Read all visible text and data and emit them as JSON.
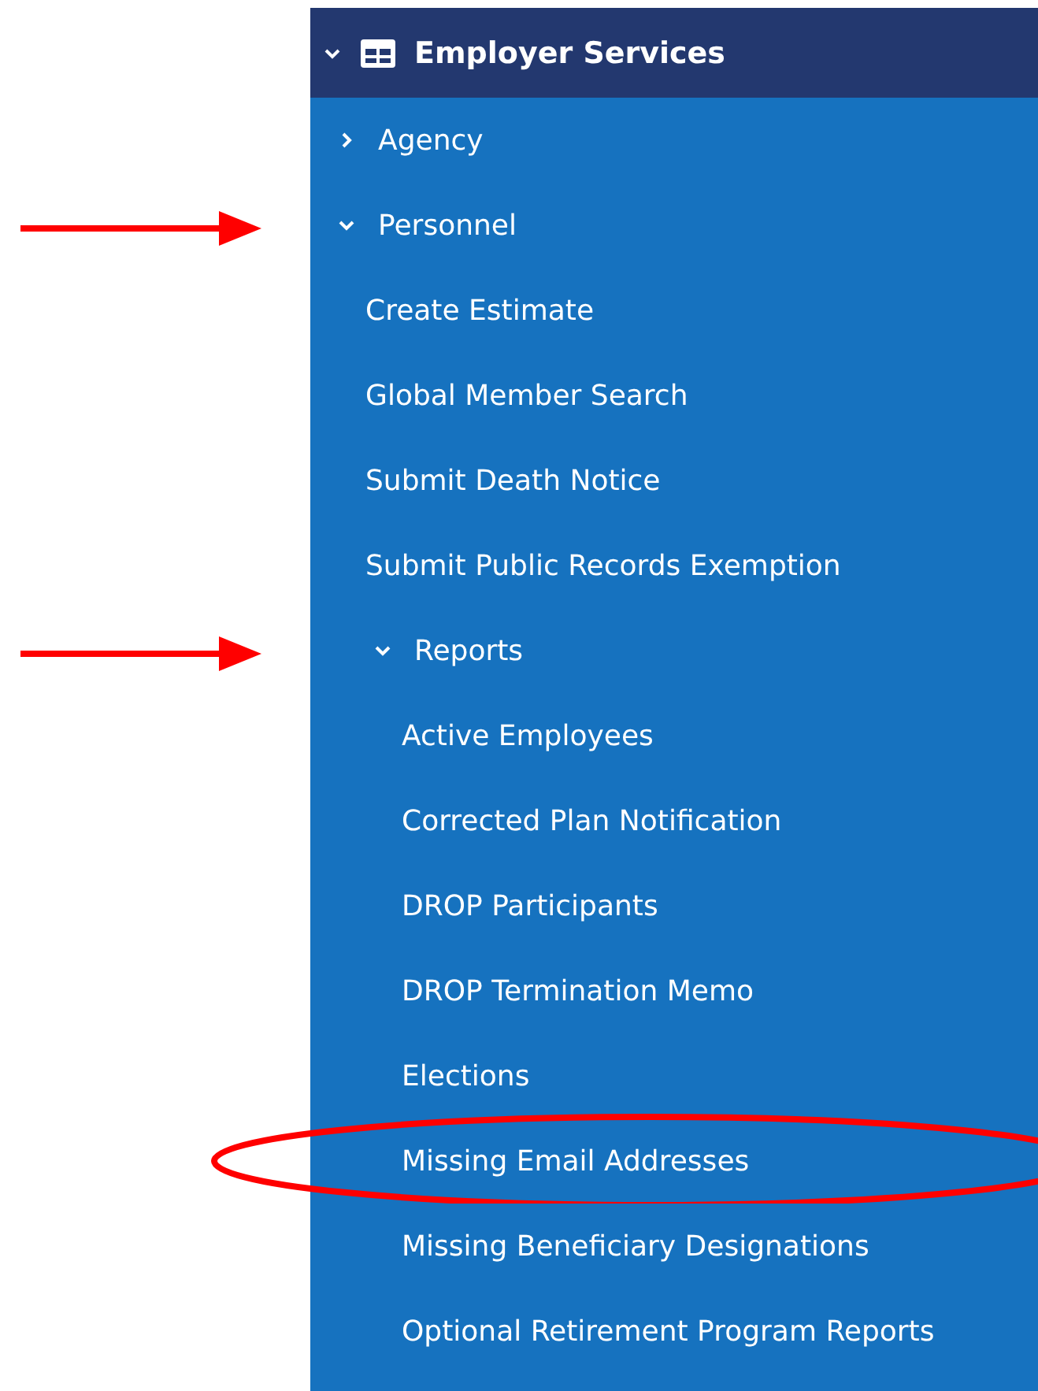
{
  "menu": {
    "label": "Employer Services",
    "expanded": true,
    "children": [
      {
        "label": "Agency",
        "kind": "group",
        "expanded": false,
        "pointed": false
      },
      {
        "label": "Personnel",
        "expanded": true,
        "pointed": true,
        "children": [
          {
            "label": "Create Estimate"
          },
          {
            "label": "Global Member Search"
          },
          {
            "label": "Submit Death Notice"
          },
          {
            "label": "Submit Public Records Exemption"
          },
          {
            "label": "Reports",
            "expanded": true,
            "pointed": true,
            "children": [
              {
                "label": "Active Employees",
                "circled": false
              },
              {
                "label": "Corrected Plan Notification",
                "circled": false
              },
              {
                "label": "DROP Participants",
                "circled": false
              },
              {
                "label": "DROP Termination Memo",
                "circled": false
              },
              {
                "label": "Elections",
                "circled": false
              },
              {
                "label": "Missing Email Addresses",
                "circled": true
              },
              {
                "label": "Missing Beneficiary Designations",
                "circled": false
              },
              {
                "label": "Optional Retirement Program Reports",
                "circled": false
              }
            ]
          }
        ]
      }
    ]
  }
}
